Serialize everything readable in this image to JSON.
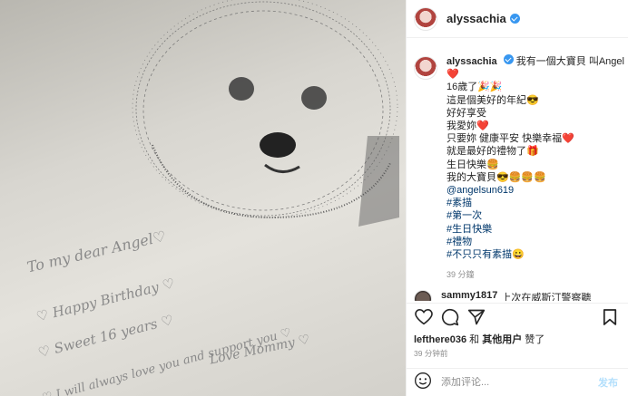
{
  "post": {
    "username": "alyssachia",
    "verified": true,
    "accent_color": "#3897f0"
  },
  "photo": {
    "handwriting": [
      "To my dear Angel♡",
      "♡ Happy Birthday ♡",
      "♡ Sweet 16 years ♡",
      "♡ I will always love you and support you ♡",
      "Love Mommy ♡"
    ]
  },
  "caption": {
    "username": "alyssachia",
    "lines": [
      "我有一個大寶貝 叫Angel",
      "❤️",
      "16歲了🎉🎉",
      "這是個美好的年紀😎",
      "好好享受",
      "我愛妳❤️",
      "只要妳 健康平安 快樂幸福❤️",
      "就是最好的禮物了🎁",
      "生日快樂🍔",
      "我的大寶貝😎🍔🍔🍔"
    ],
    "mention": "@angelsun619",
    "hashtags": [
      "#素描",
      "#第一次",
      "#生日快樂",
      "#禮物",
      "#不只只有素描😀"
    ],
    "time": "39 分鐘"
  },
  "comment": {
    "username": "sammy1817",
    "text": "上次在威斯汀警察聽"
  },
  "likes": {
    "user": "lefthere036",
    "conjunction": "和",
    "others": "其他用户",
    "verb": "赞了"
  },
  "posted_time": "39 分钟前",
  "add_comment": {
    "placeholder": "添加评论...",
    "post_label": "发布"
  },
  "icons": [
    "heart-icon",
    "comment-icon",
    "share-icon",
    "bookmark-icon",
    "emoji-icon",
    "chevron-right-icon"
  ]
}
